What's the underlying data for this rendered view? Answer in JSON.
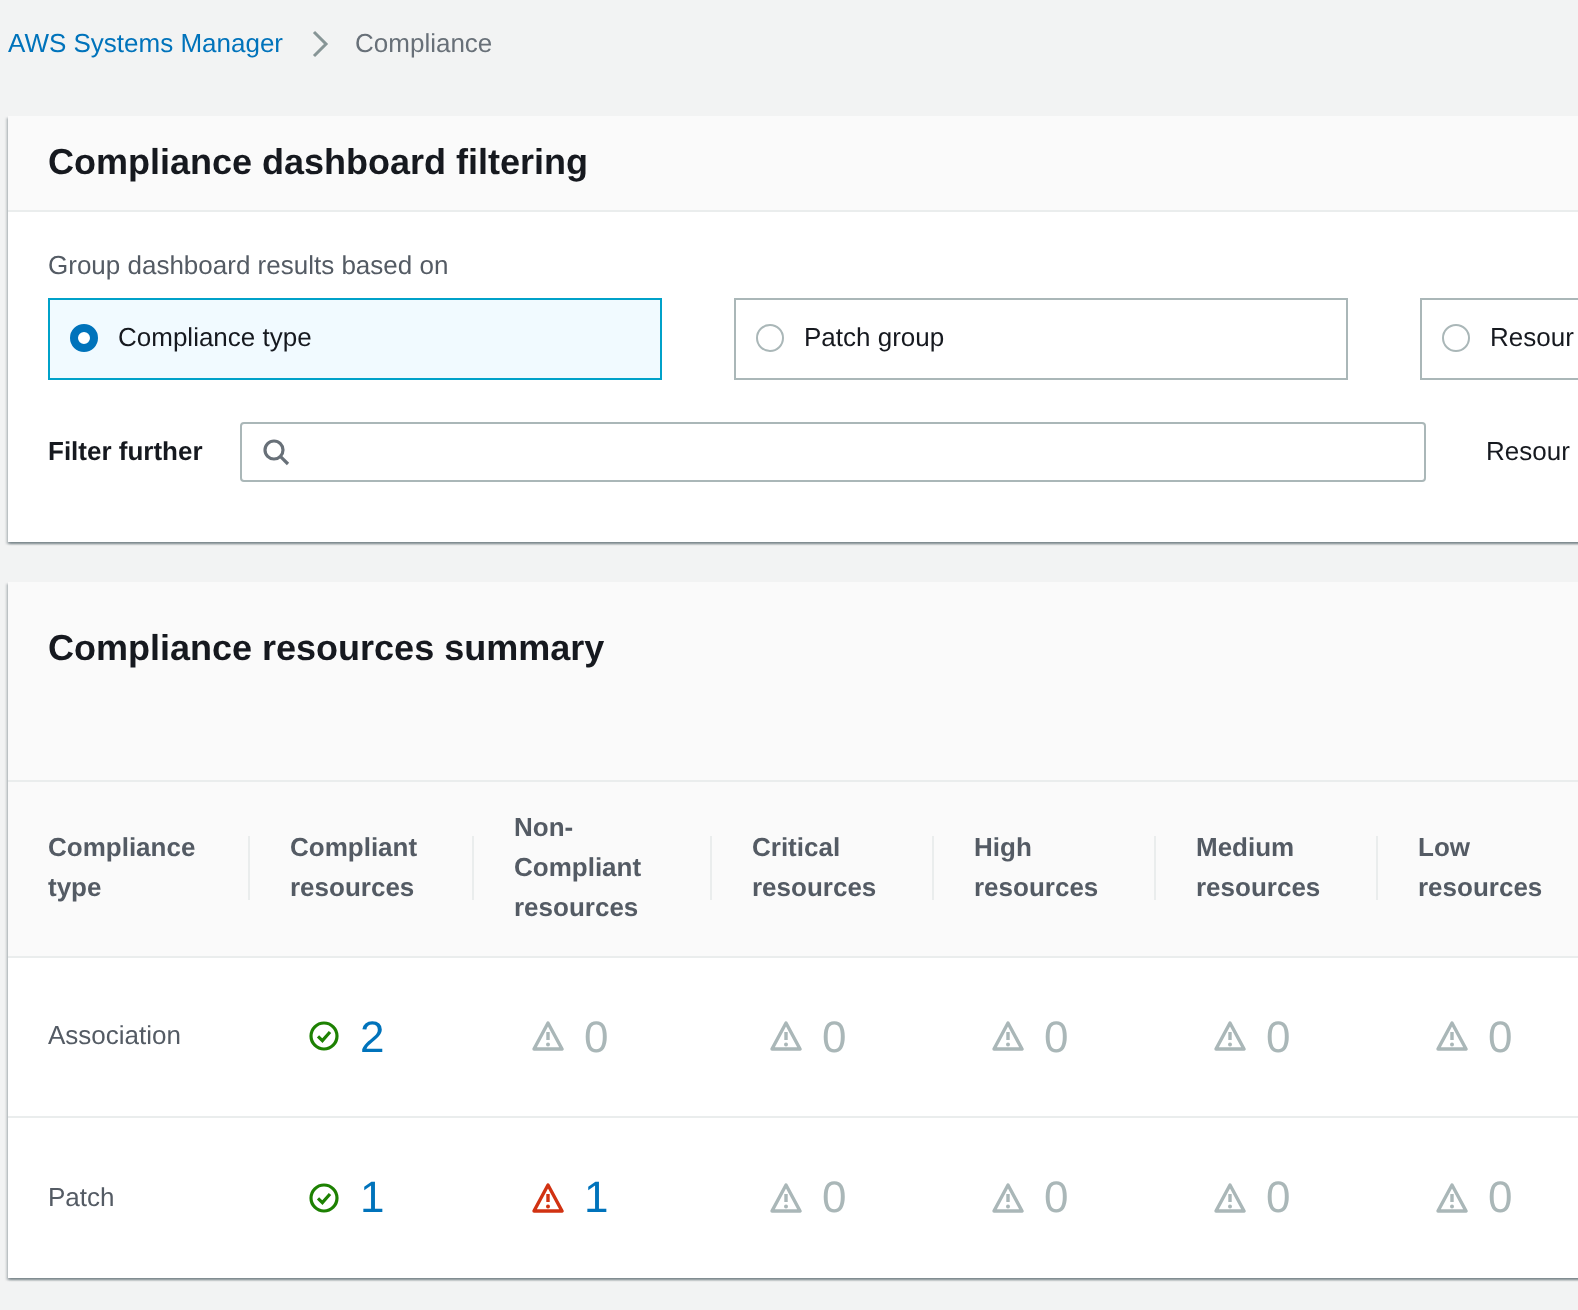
{
  "breadcrumb": [
    {
      "label": "AWS Systems Manager",
      "link": true
    },
    {
      "label": "Compliance",
      "link": false
    }
  ],
  "filtering": {
    "title": "Compliance dashboard filtering",
    "group_label": "Group dashboard results based on",
    "options": [
      {
        "label": "Compliance type",
        "selected": true
      },
      {
        "label": "Patch group",
        "selected": false
      },
      {
        "label": "Resour",
        "selected": false
      }
    ],
    "filter_label": "Filter further",
    "resource_label": "Resour"
  },
  "summary": {
    "title": "Compliance resources summary",
    "columns": [
      "Compliance type",
      "Compliant resources",
      "Non-Compliant resources",
      "Critical resources",
      "High resources",
      "Medium resources",
      "Low resources"
    ],
    "rows": [
      {
        "cells": [
          {
            "kind": "text",
            "value": "Association"
          },
          {
            "kind": "ok",
            "value": "2"
          },
          {
            "kind": "zero",
            "value": "0"
          },
          {
            "kind": "zero",
            "value": "0"
          },
          {
            "kind": "zero",
            "value": "0"
          },
          {
            "kind": "zero",
            "value": "0"
          },
          {
            "kind": "zero",
            "value": "0"
          }
        ]
      },
      {
        "cells": [
          {
            "kind": "text",
            "value": "Patch"
          },
          {
            "kind": "ok",
            "value": "1"
          },
          {
            "kind": "alert",
            "value": "1"
          },
          {
            "kind": "zero",
            "value": "0"
          },
          {
            "kind": "zero",
            "value": "0"
          },
          {
            "kind": "zero",
            "value": "0"
          },
          {
            "kind": "zero",
            "value": "0"
          }
        ]
      }
    ]
  }
}
